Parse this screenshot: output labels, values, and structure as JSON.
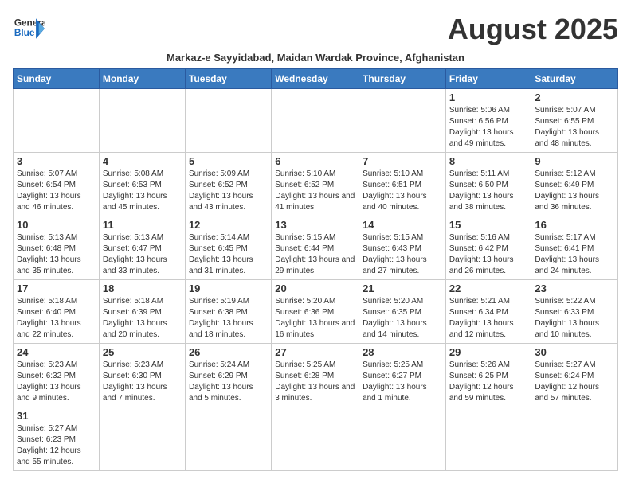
{
  "header": {
    "logo_line1": "General",
    "logo_line2": "Blue",
    "month_title": "August 2025",
    "subtitle": "Markaz-e Sayyidabad, Maidan Wardak Province, Afghanistan"
  },
  "weekdays": [
    "Sunday",
    "Monday",
    "Tuesday",
    "Wednesday",
    "Thursday",
    "Friday",
    "Saturday"
  ],
  "weeks": [
    [
      {
        "day": "",
        "info": ""
      },
      {
        "day": "",
        "info": ""
      },
      {
        "day": "",
        "info": ""
      },
      {
        "day": "",
        "info": ""
      },
      {
        "day": "",
        "info": ""
      },
      {
        "day": "1",
        "info": "Sunrise: 5:06 AM\nSunset: 6:56 PM\nDaylight: 13 hours and 49 minutes."
      },
      {
        "day": "2",
        "info": "Sunrise: 5:07 AM\nSunset: 6:55 PM\nDaylight: 13 hours and 48 minutes."
      }
    ],
    [
      {
        "day": "3",
        "info": "Sunrise: 5:07 AM\nSunset: 6:54 PM\nDaylight: 13 hours and 46 minutes."
      },
      {
        "day": "4",
        "info": "Sunrise: 5:08 AM\nSunset: 6:53 PM\nDaylight: 13 hours and 45 minutes."
      },
      {
        "day": "5",
        "info": "Sunrise: 5:09 AM\nSunset: 6:52 PM\nDaylight: 13 hours and 43 minutes."
      },
      {
        "day": "6",
        "info": "Sunrise: 5:10 AM\nSunset: 6:52 PM\nDaylight: 13 hours and 41 minutes."
      },
      {
        "day": "7",
        "info": "Sunrise: 5:10 AM\nSunset: 6:51 PM\nDaylight: 13 hours and 40 minutes."
      },
      {
        "day": "8",
        "info": "Sunrise: 5:11 AM\nSunset: 6:50 PM\nDaylight: 13 hours and 38 minutes."
      },
      {
        "day": "9",
        "info": "Sunrise: 5:12 AM\nSunset: 6:49 PM\nDaylight: 13 hours and 36 minutes."
      }
    ],
    [
      {
        "day": "10",
        "info": "Sunrise: 5:13 AM\nSunset: 6:48 PM\nDaylight: 13 hours and 35 minutes."
      },
      {
        "day": "11",
        "info": "Sunrise: 5:13 AM\nSunset: 6:47 PM\nDaylight: 13 hours and 33 minutes."
      },
      {
        "day": "12",
        "info": "Sunrise: 5:14 AM\nSunset: 6:45 PM\nDaylight: 13 hours and 31 minutes."
      },
      {
        "day": "13",
        "info": "Sunrise: 5:15 AM\nSunset: 6:44 PM\nDaylight: 13 hours and 29 minutes."
      },
      {
        "day": "14",
        "info": "Sunrise: 5:15 AM\nSunset: 6:43 PM\nDaylight: 13 hours and 27 minutes."
      },
      {
        "day": "15",
        "info": "Sunrise: 5:16 AM\nSunset: 6:42 PM\nDaylight: 13 hours and 26 minutes."
      },
      {
        "day": "16",
        "info": "Sunrise: 5:17 AM\nSunset: 6:41 PM\nDaylight: 13 hours and 24 minutes."
      }
    ],
    [
      {
        "day": "17",
        "info": "Sunrise: 5:18 AM\nSunset: 6:40 PM\nDaylight: 13 hours and 22 minutes."
      },
      {
        "day": "18",
        "info": "Sunrise: 5:18 AM\nSunset: 6:39 PM\nDaylight: 13 hours and 20 minutes."
      },
      {
        "day": "19",
        "info": "Sunrise: 5:19 AM\nSunset: 6:38 PM\nDaylight: 13 hours and 18 minutes."
      },
      {
        "day": "20",
        "info": "Sunrise: 5:20 AM\nSunset: 6:36 PM\nDaylight: 13 hours and 16 minutes."
      },
      {
        "day": "21",
        "info": "Sunrise: 5:20 AM\nSunset: 6:35 PM\nDaylight: 13 hours and 14 minutes."
      },
      {
        "day": "22",
        "info": "Sunrise: 5:21 AM\nSunset: 6:34 PM\nDaylight: 13 hours and 12 minutes."
      },
      {
        "day": "23",
        "info": "Sunrise: 5:22 AM\nSunset: 6:33 PM\nDaylight: 13 hours and 10 minutes."
      }
    ],
    [
      {
        "day": "24",
        "info": "Sunrise: 5:23 AM\nSunset: 6:32 PM\nDaylight: 13 hours and 9 minutes."
      },
      {
        "day": "25",
        "info": "Sunrise: 5:23 AM\nSunset: 6:30 PM\nDaylight: 13 hours and 7 minutes."
      },
      {
        "day": "26",
        "info": "Sunrise: 5:24 AM\nSunset: 6:29 PM\nDaylight: 13 hours and 5 minutes."
      },
      {
        "day": "27",
        "info": "Sunrise: 5:25 AM\nSunset: 6:28 PM\nDaylight: 13 hours and 3 minutes."
      },
      {
        "day": "28",
        "info": "Sunrise: 5:25 AM\nSunset: 6:27 PM\nDaylight: 13 hours and 1 minute."
      },
      {
        "day": "29",
        "info": "Sunrise: 5:26 AM\nSunset: 6:25 PM\nDaylight: 12 hours and 59 minutes."
      },
      {
        "day": "30",
        "info": "Sunrise: 5:27 AM\nSunset: 6:24 PM\nDaylight: 12 hours and 57 minutes."
      }
    ],
    [
      {
        "day": "31",
        "info": "Sunrise: 5:27 AM\nSunset: 6:23 PM\nDaylight: 12 hours and 55 minutes."
      },
      {
        "day": "",
        "info": ""
      },
      {
        "day": "",
        "info": ""
      },
      {
        "day": "",
        "info": ""
      },
      {
        "day": "",
        "info": ""
      },
      {
        "day": "",
        "info": ""
      },
      {
        "day": "",
        "info": ""
      }
    ]
  ]
}
